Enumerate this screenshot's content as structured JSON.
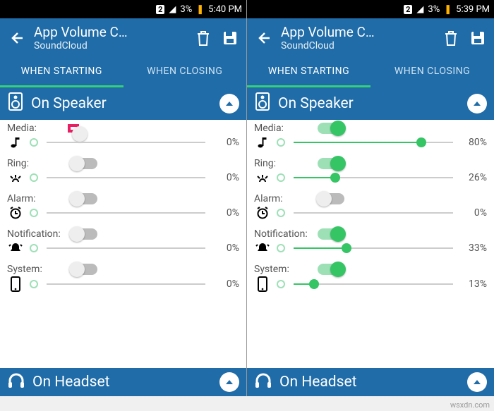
{
  "watermark": "wsxdn.com",
  "screens": [
    {
      "status": {
        "sim": "2",
        "battery_pct": "3%",
        "time": "5:40 PM"
      },
      "appbar": {
        "title": "App Volume C…",
        "subtitle": "SoundCloud"
      },
      "tabs": {
        "starting": "WHEN STARTING",
        "closing": "WHEN CLOSING",
        "active": 0
      },
      "section_speaker": "On Speaker",
      "section_headset": "On Headset",
      "rows": [
        {
          "label": "Media:",
          "on": false,
          "pct": 0,
          "icon": "music",
          "highlight": true
        },
        {
          "label": "Ring:",
          "on": false,
          "pct": 0,
          "icon": "ring"
        },
        {
          "label": "Alarm:",
          "on": false,
          "pct": 0,
          "icon": "alarm"
        },
        {
          "label": "Notification:",
          "on": false,
          "pct": 0,
          "icon": "bell"
        },
        {
          "label": "System:",
          "on": false,
          "pct": 0,
          "icon": "phone"
        }
      ]
    },
    {
      "status": {
        "sim": "2",
        "battery_pct": "3%",
        "time": "5:39 PM"
      },
      "appbar": {
        "title": "App Volume C…",
        "subtitle": "SoundCloud"
      },
      "tabs": {
        "starting": "WHEN STARTING",
        "closing": "WHEN CLOSING",
        "active": 0
      },
      "section_speaker": "On Speaker",
      "section_headset": "On Headset",
      "rows": [
        {
          "label": "Media:",
          "on": true,
          "pct": 80,
          "icon": "music"
        },
        {
          "label": "Ring:",
          "on": true,
          "pct": 26,
          "icon": "ring"
        },
        {
          "label": "Alarm:",
          "on": false,
          "pct": 0,
          "icon": "alarm"
        },
        {
          "label": "Notification:",
          "on": true,
          "pct": 33,
          "icon": "bell"
        },
        {
          "label": "System:",
          "on": true,
          "pct": 13,
          "icon": "phone"
        }
      ]
    }
  ],
  "icons": {
    "back": "←",
    "signal": "◢",
    "battery": "▮"
  }
}
